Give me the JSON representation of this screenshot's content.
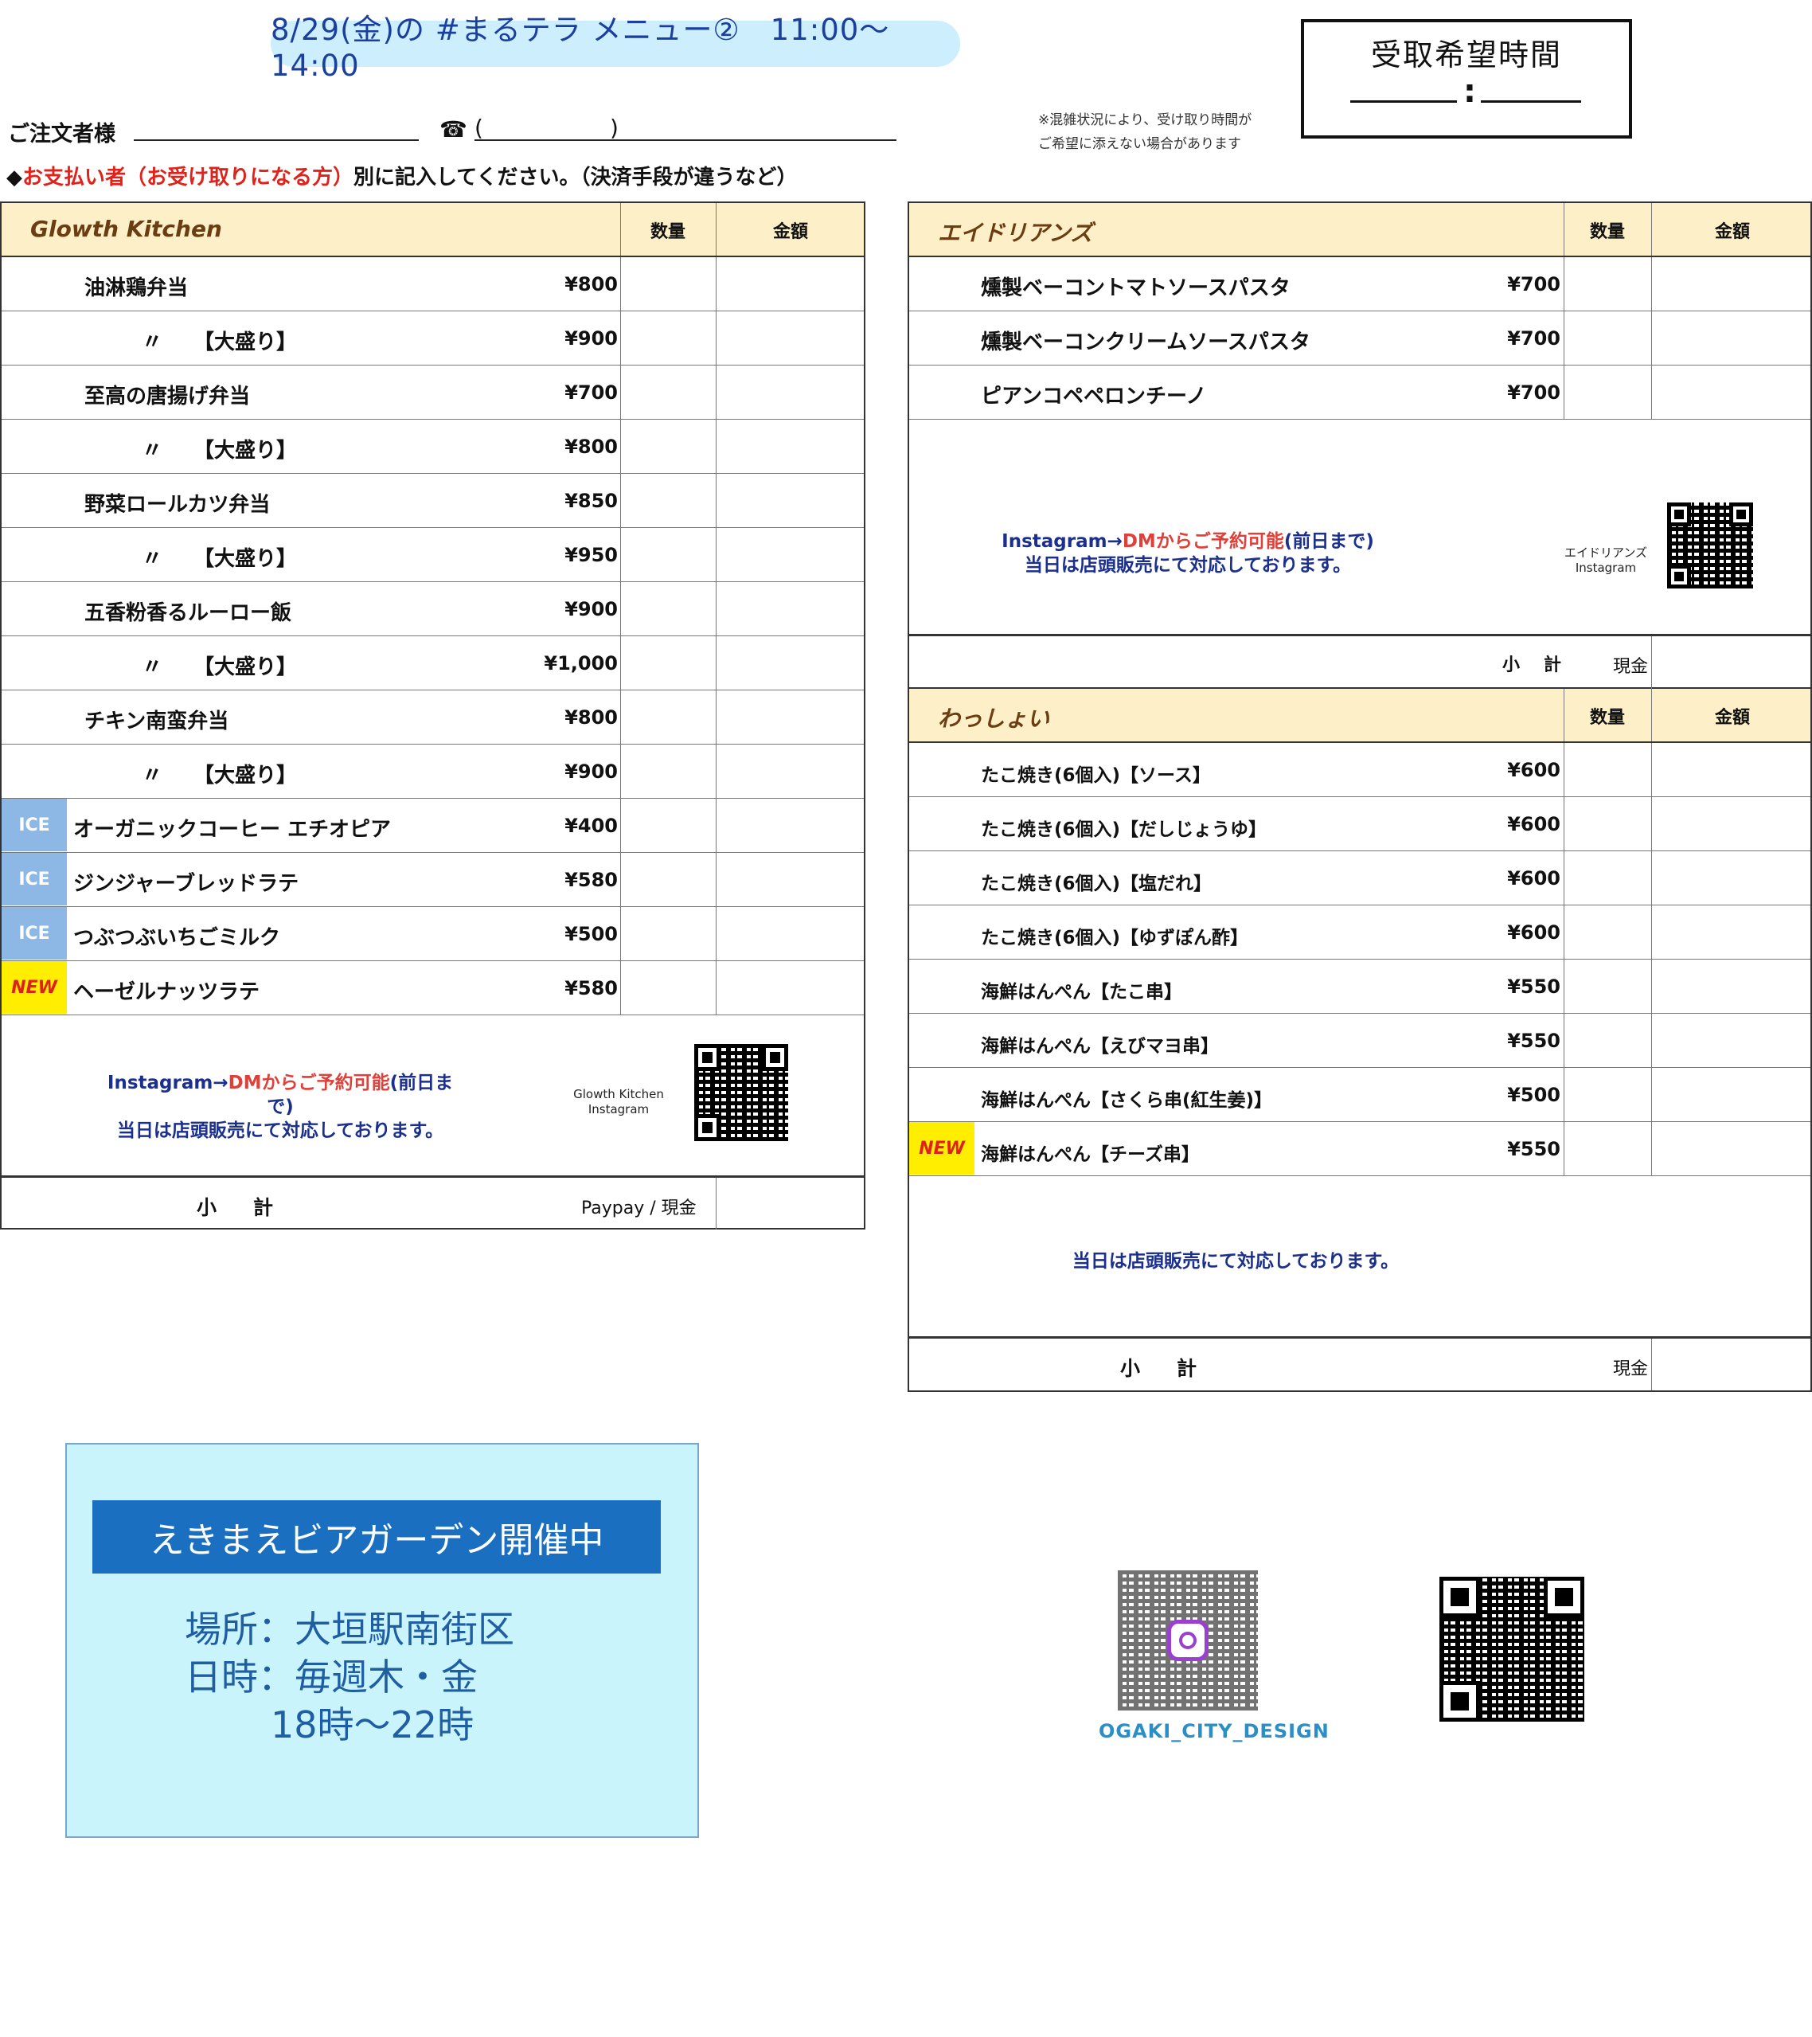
{
  "header": {
    "title": "8/29(金)の #まるテラ メニュー②　11:00〜14:00",
    "orderer_label": "ご注文者様",
    "phone_icon": "☎",
    "phone_open": "(",
    "phone_close": ")",
    "note_prefix": "◆",
    "note_red": "お支払い者（お受け取りになる方）",
    "note_rest": "別に記入してください。（決済手段が違うなど）",
    "crowd_note_1": "※混雑状況により、受け取り時間が",
    "crowd_note_2": "ご希望に添えない場合があります",
    "pickup_title": "受取希望時間",
    "pickup_colon": ":"
  },
  "columns": {
    "qty": "数量",
    "amount": "金額"
  },
  "glowth": {
    "name": "Glowth Kitchen",
    "items": [
      {
        "name": "油淋鶏弁当",
        "price": "¥800"
      },
      {
        "name": "〃　　【大盛り】",
        "price": "¥900"
      },
      {
        "name": "至高の唐揚げ弁当",
        "price": "¥700"
      },
      {
        "name": "〃　　【大盛り】",
        "price": "¥800"
      },
      {
        "name": "野菜ロールカツ弁当",
        "price": "¥850"
      },
      {
        "name": "〃　　【大盛り】",
        "price": "¥950"
      },
      {
        "name": "五香粉香るルーロー飯",
        "price": "¥900"
      },
      {
        "name": "〃　　【大盛り】",
        "price": "¥1,000"
      },
      {
        "name": "チキン南蛮弁当",
        "price": "¥800"
      },
      {
        "name": "〃　　【大盛り】",
        "price": "¥900"
      },
      {
        "name": "オーガニックコーヒー エチオピア",
        "price": "¥400",
        "badge": "ICE"
      },
      {
        "name": "ジンジャーブレッドラテ",
        "price": "¥580",
        "badge": "ICE"
      },
      {
        "name": "つぶつぶいちごミルク",
        "price": "¥500",
        "badge": "ICE"
      },
      {
        "name": "ヘーゼルナッツラテ",
        "price": "¥580",
        "badge": "NEW"
      }
    ],
    "insta_line1_a": "Instagram→",
    "insta_line1_b": "DMからご予約可能",
    "insta_line1_c": "(前日まで)",
    "insta_line2": "当日は店頭販売にて対応しております。",
    "qr_caption_1": "Glowth Kitchen",
    "qr_caption_2": "Instagram",
    "subtotal": "小計",
    "payment": "Paypay / 現金"
  },
  "adrians": {
    "name": "エイドリアンズ",
    "items": [
      {
        "name": "燻製ベーコントマトソースパスタ",
        "price": "¥700"
      },
      {
        "name": "燻製ベーコンクリームソースパスタ",
        "price": "¥700"
      },
      {
        "name": "ピアンコペペロンチーノ",
        "price": "¥700"
      }
    ],
    "insta_line1_a": "Instagram→",
    "insta_line1_b": "DMからご予約可能",
    "insta_line1_c": "(前日まで)",
    "insta_line2": "当日は店頭販売にて対応しております。",
    "qr_caption_1": "エイドリアンズ",
    "qr_caption_2": "Instagram",
    "subtotal": "小計",
    "payment": "現金"
  },
  "wasshoi": {
    "name": "わっしょい",
    "items": [
      {
        "name": "たこ焼き(6個入)【ソース】",
        "price": "¥600"
      },
      {
        "name": "たこ焼き(6個入)【だしじょうゆ】",
        "price": "¥600"
      },
      {
        "name": "たこ焼き(6個入)【塩だれ】",
        "price": "¥600"
      },
      {
        "name": "たこ焼き(6個入)【ゆずぽん酢】",
        "price": "¥600"
      },
      {
        "name": "海鮮はんぺん【たこ串】",
        "price": "¥550"
      },
      {
        "name": "海鮮はんぺん【えびマヨ串】",
        "price": "¥550"
      },
      {
        "name": "海鮮はんぺん【さくら串(紅生姜)】",
        "price": "¥500"
      },
      {
        "name": "海鮮はんぺん【チーズ串】",
        "price": "¥550",
        "badge": "NEW"
      }
    ],
    "note": "当日は店頭販売にて対応しております。",
    "subtotal": "小計",
    "payment": "現金"
  },
  "beer_garden": {
    "title": "えきまえビアガーデン開催中",
    "place": "場所：大垣駅南街区",
    "date": "日時：毎週木・金",
    "time": "18時〜22時"
  },
  "footer": {
    "qr_label": "OGAKI_CITY_DESIGN"
  },
  "colors": {
    "title_pill": "#cdeefc",
    "header_row": "#fdf0c8",
    "ice_badge": "#8db8e6",
    "new_badge": "#ffee00",
    "beer_box": "#c9f4fb",
    "beer_title": "#1a6fc0"
  }
}
